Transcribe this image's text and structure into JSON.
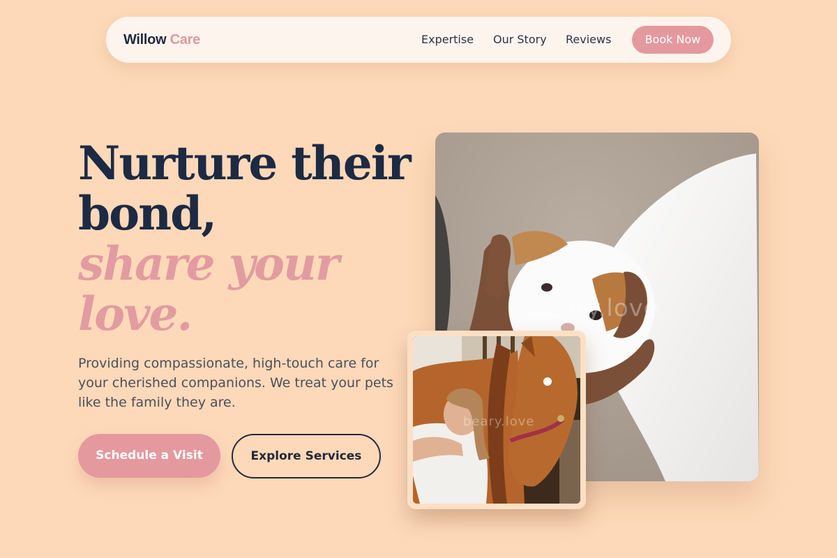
{
  "nav": {
    "brand_primary": "Willow",
    "brand_accent": "Care",
    "links": [
      "Expertise",
      "Our Story",
      "Reviews"
    ],
    "cta": "Book Now"
  },
  "hero": {
    "headline_line1": "Nurture their",
    "headline_line2": "bond,",
    "accent_line1": "share your",
    "accent_line2": "love.",
    "subtitle": "Providing compassionate, high-touch care for your cherished companions. We treat your pets like the family they are.",
    "primary_cta": "Schedule a Visit",
    "secondary_cta": "Explore Services"
  },
  "images": {
    "main_watermark": "beary.love",
    "inset_watermark": "beary.love"
  },
  "colors": {
    "background": "#fdd9b9",
    "navy": "#1d2a43",
    "accent_pink": "#e4999e",
    "nav_bg": "#fef4ee"
  }
}
